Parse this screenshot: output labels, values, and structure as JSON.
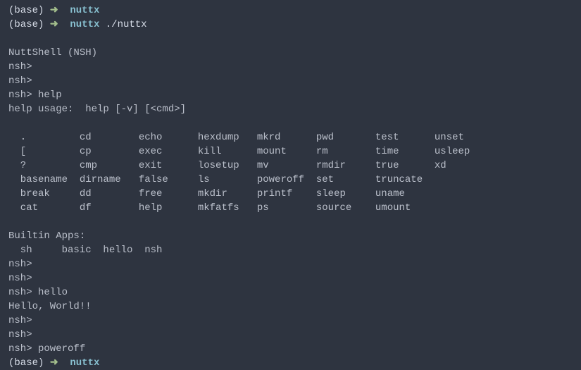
{
  "prompt_lines": [
    {
      "base": "(base) ",
      "arrow": "➜  ",
      "dir": "nuttx",
      "cmd": ""
    },
    {
      "base": "(base) ",
      "arrow": "➜  ",
      "dir": "nuttx",
      "cmd": " ./nuttx"
    }
  ],
  "output": {
    "blank1": "",
    "shell_title": "NuttShell (NSH)",
    "nsh1": "nsh>",
    "nsh2": "nsh>",
    "nsh_help": "nsh> help",
    "help_usage": "help usage:  help [-v] [<cmd>]",
    "blank2": "",
    "cmd_row1": "  .         cd        echo      hexdump   mkrd      pwd       test      unset",
    "cmd_row2": "  [         cp        exec      kill      mount     rm        time      usleep",
    "cmd_row3": "  ?         cmp       exit      losetup   mv        rmdir     true      xd",
    "cmd_row4": "  basename  dirname   false     ls        poweroff  set       truncate",
    "cmd_row5": "  break     dd        free      mkdir     printf    sleep     uname",
    "cmd_row6": "  cat       df        help      mkfatfs   ps        source    umount",
    "blank3": "",
    "builtin_title": "Builtin Apps:",
    "builtin_row": "  sh     basic  hello  nsh",
    "nsh3": "nsh>",
    "nsh4": "nsh>",
    "nsh_hello": "nsh> hello",
    "hello_out": "Hello, World!!",
    "nsh5": "nsh>",
    "nsh6": "nsh>",
    "nsh_poweroff": "nsh> poweroff"
  },
  "prompt_end": {
    "base": "(base) ",
    "arrow": "➜  ",
    "dir": "nuttx",
    "cmd": ""
  }
}
